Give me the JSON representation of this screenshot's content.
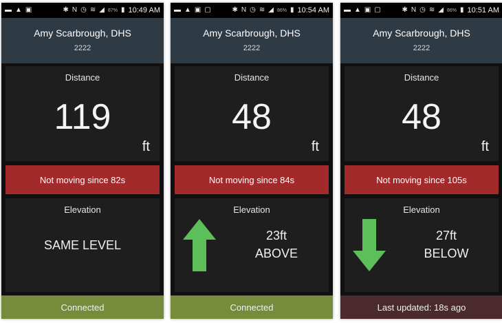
{
  "colors": {
    "header": "#2e3a44",
    "panel": "#1e1e1e",
    "alert": "#a32a2a",
    "arrow": "#5cbf59",
    "footer_connected": "#778c3b",
    "footer_stale": "#4a2a2c"
  },
  "screens": [
    {
      "status": {
        "battery": "87%",
        "time": "10:49 AM"
      },
      "contact": {
        "name": "Amy Scarbrough, DHS",
        "id": "2222"
      },
      "distance": {
        "label": "Distance",
        "value": "119",
        "unit": "ft"
      },
      "motion": {
        "text": "Not moving since 82s"
      },
      "elevation": {
        "label": "Elevation",
        "level_text": "SAME LEVEL",
        "amount": "",
        "direction_text": "",
        "arrow": "none"
      },
      "footer": {
        "text": "Connected",
        "state": "connected"
      }
    },
    {
      "status": {
        "battery": "86%",
        "time": "10:54 AM"
      },
      "contact": {
        "name": "Amy Scarbrough, DHS",
        "id": "2222"
      },
      "distance": {
        "label": "Distance",
        "value": "48",
        "unit": "ft"
      },
      "motion": {
        "text": "Not moving since 84s"
      },
      "elevation": {
        "label": "Elevation",
        "level_text": "",
        "amount": "23ft",
        "direction_text": "ABOVE",
        "arrow": "up-arrow-icon"
      },
      "footer": {
        "text": "Connected",
        "state": "connected"
      }
    },
    {
      "status": {
        "battery": "86%",
        "time": "10:51 AM"
      },
      "contact": {
        "name": "Amy Scarbrough, DHS",
        "id": "2222"
      },
      "distance": {
        "label": "Distance",
        "value": "48",
        "unit": "ft"
      },
      "motion": {
        "text": "Not moving since 105s"
      },
      "elevation": {
        "label": "Elevation",
        "level_text": "",
        "amount": "27ft",
        "direction_text": "BELOW",
        "arrow": "down-arrow-icon"
      },
      "footer": {
        "text": "Last updated: 18s ago",
        "state": "stale"
      }
    }
  ]
}
